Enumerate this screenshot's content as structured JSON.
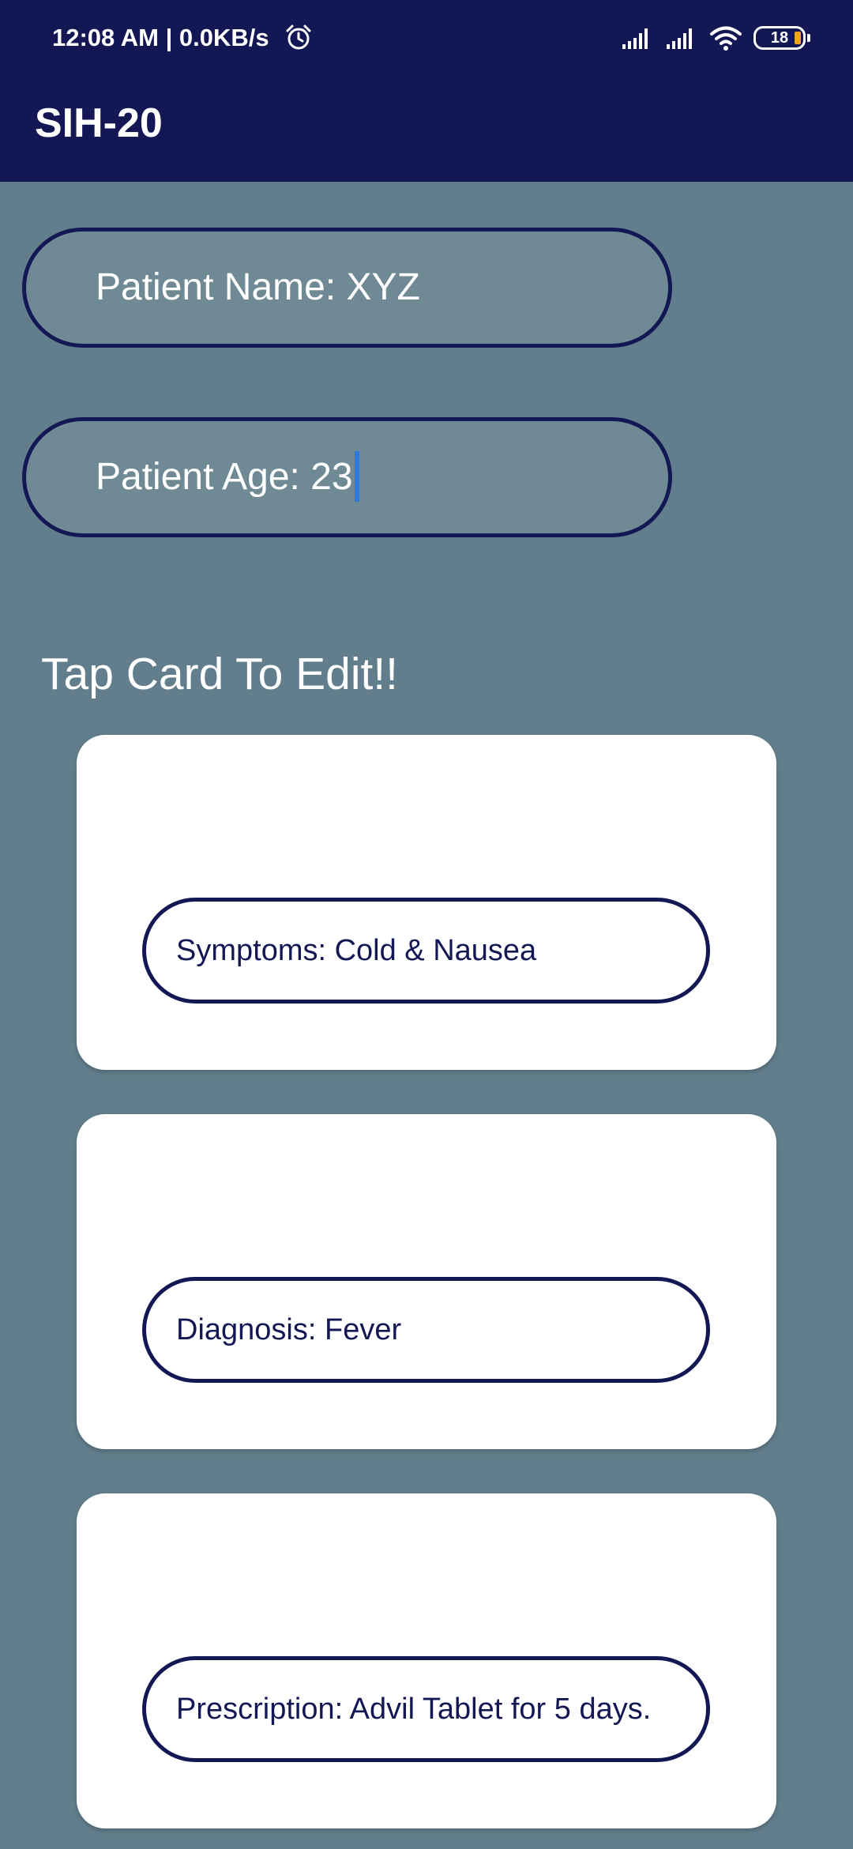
{
  "status_bar": {
    "time_speed": "12:08 AM | 0.0KB/s",
    "battery_level": "18",
    "icons": [
      "alarm-icon",
      "signal-icon",
      "signal-icon",
      "wifi-icon",
      "battery-icon"
    ]
  },
  "app_bar": {
    "title": "SIH-20"
  },
  "form": {
    "patient_name": "Patient Name: XYZ",
    "patient_age": "Patient Age: 23"
  },
  "section": {
    "heading": "Tap Card To Edit!!"
  },
  "cards": [
    {
      "label": "Symptoms: Cold & Nausea"
    },
    {
      "label": "Diagnosis: Fever"
    },
    {
      "label": "Prescription: Advil Tablet for 5 days."
    }
  ],
  "colors": {
    "primary": "#131854",
    "background": "#627d8b",
    "field_fill": "#6f8a94",
    "caret": "#2d7ad8",
    "battery_accent": "#f1a22c"
  }
}
